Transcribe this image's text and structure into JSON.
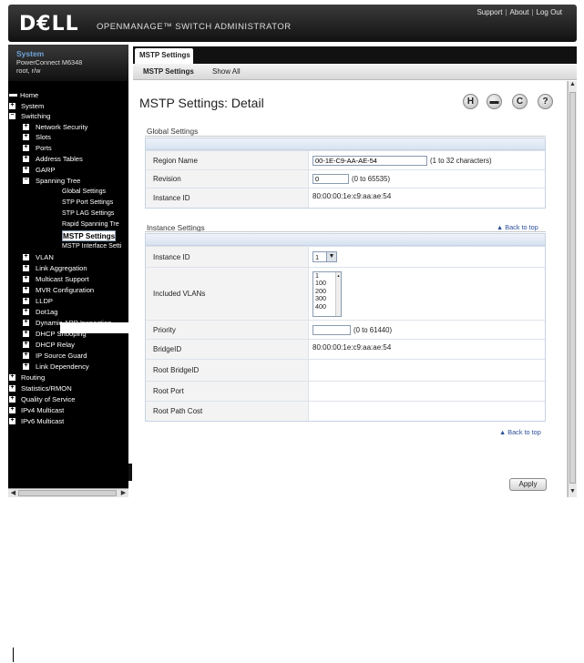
{
  "header": {
    "logo": "D€LL",
    "product": "OPENMANAGE™ SWITCH ADMINISTRATOR",
    "links": [
      "Support",
      "About",
      "Log Out"
    ]
  },
  "device": {
    "title": "System",
    "model": "PowerConnect M6348",
    "user": "root, r/w"
  },
  "tree": {
    "home": "Home",
    "system": "System",
    "switching": "Switching",
    "network_security": "Network Security",
    "slots": "Slots",
    "ports": "Ports",
    "address_tables": "Address Tables",
    "garp": "GARP",
    "spanning_tree": "Spanning Tree",
    "global_settings": "Global Settings",
    "stp_port_settings": "STP Port Settings",
    "stp_lag_settings": "STP LAG Settings",
    "rapid_spanning": "Rapid Spanning Tre",
    "mstp_settings": "MSTP Settings",
    "mstp_interface": "MSTP Interface Setti",
    "vlan": "VLAN",
    "link_aggregation": "Link Aggregation",
    "multicast_support": "Multicast Support",
    "mvr_configuration": "MVR Configuration",
    "lldp": "LLDP",
    "dot1ag": "Dot1ag",
    "dynamic_arp": "Dynamic ARP Inspection",
    "dhcp_snooping": "DHCP Snooping",
    "dhcp_relay": "DHCP Relay",
    "ip_source_guard": "IP Source Guard",
    "link_dependency": "Link Dependency",
    "routing": "Routing",
    "statistics_rmon": "Statistics/RMON",
    "quality_of_service": "Quality of Service",
    "ipv4_multicast": "IPv4 Multicast",
    "ipv6_multicast": "IPv6 Multicast"
  },
  "tabs": {
    "active": "MSTP Settings",
    "sub_detail": "MSTP Settings",
    "sub_showall": "Show All"
  },
  "page": {
    "title": "MSTP Settings: Detail",
    "icons": {
      "save": "H",
      "print": "▬",
      "refresh": "C",
      "help": "?"
    }
  },
  "global": {
    "section_title": "Global Settings",
    "region_name_label": "Region Name",
    "region_name_value": "00-1E-C9-AA-AE-54",
    "region_name_hint": "(1 to 32 characters)",
    "revision_label": "Revision",
    "revision_value": "0",
    "revision_hint": "(0 to 65535)",
    "instance_id_label": "Instance ID",
    "instance_id_value": "80:00:00:1e:c9:aa:ae:54"
  },
  "instance": {
    "section_title": "Instance Settings",
    "back_to_top": "Back to top",
    "instance_id_label": "Instance ID",
    "instance_id_selected": "1",
    "included_vlans_label": "Included VLANs",
    "included_vlans": [
      "1",
      "100",
      "200",
      "300",
      "400"
    ],
    "priority_label": "Priority",
    "priority_value": "",
    "priority_hint": "(0 to 61440)",
    "bridge_id_label": "BridgeID",
    "bridge_id_value": "80:00:00:1e:c9:aa:ae:54",
    "root_bridge_id_label": "Root BridgeID",
    "root_bridge_id_value": "",
    "root_port_label": "Root Port",
    "root_port_value": "",
    "root_path_cost_label": "Root Path Cost",
    "root_path_cost_value": ""
  },
  "footer": {
    "back_to_top": "Back to top",
    "apply": "Apply"
  }
}
